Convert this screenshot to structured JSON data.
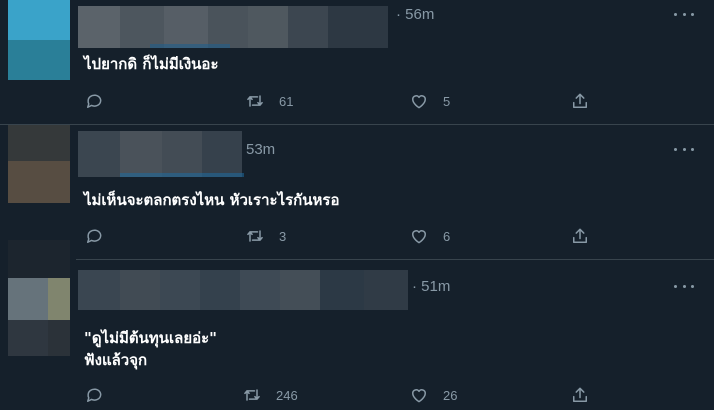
{
  "tweets": [
    {
      "time": "· 56m",
      "text_lines": [
        "ไปยากดิ ก็ไม่มีเงินอะ"
      ],
      "replies": "",
      "retweets": "61",
      "likes": "5"
    },
    {
      "time": "53m",
      "text_lines": [
        "ไม่เห็นจะตลกตรงไหน หัวเราะไรกันหรอ"
      ],
      "replies": "",
      "retweets": "3",
      "likes": "6"
    },
    {
      "time": "· 51m",
      "text_lines": [
        "\"ดูไม่มีต้นทุนเลยอ่ะ\"",
        "ฟังแล้วจุก"
      ],
      "replies": "",
      "retweets": "246",
      "likes": "26"
    }
  ],
  "icons": {
    "reply": "reply-icon",
    "retweet": "retweet-icon",
    "like": "heart-icon",
    "share": "share-icon",
    "more": "more-icon"
  },
  "colors": {
    "background": "#15202b",
    "muted": "#8899a6",
    "divider": "#38444d"
  }
}
